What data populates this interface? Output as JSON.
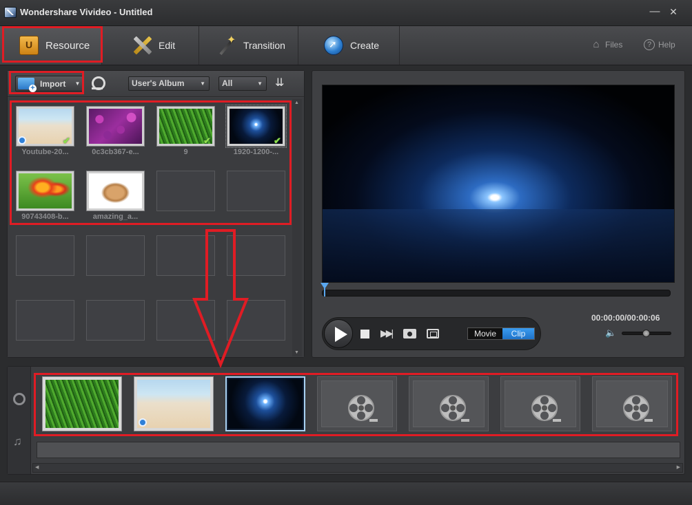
{
  "window": {
    "title": "Wondershare Vivideo - Untitled",
    "minimize_glyph": "—",
    "close_glyph": "✕"
  },
  "nav": {
    "tabs": [
      {
        "label": "Resource",
        "icon": "storage-box-icon"
      },
      {
        "label": "Edit",
        "icon": "pencil-icon"
      },
      {
        "label": "Transition",
        "icon": "magic-wand-icon"
      },
      {
        "label": "Create",
        "icon": "globe-icon"
      }
    ],
    "files_label": "Files",
    "help_label": "Help"
  },
  "resource": {
    "import_label": "Import",
    "album_select": "User's Album",
    "filter_select": "All",
    "thumbnails": [
      {
        "label": "Youtube-20...",
        "image": "beach",
        "checked": true,
        "video_badge": true
      },
      {
        "label": "0c3cb367-e...",
        "image": "flowers",
        "checked": false,
        "video_badge": false
      },
      {
        "label": "9",
        "image": "grass",
        "checked": true,
        "video_badge": false
      },
      {
        "label": "1920-1200-...",
        "image": "night-sea",
        "checked": true,
        "video_badge": false
      },
      {
        "label": "90743408-b...",
        "image": "tulip",
        "checked": false,
        "video_badge": false
      },
      {
        "label": "amazing_a...",
        "image": "kitten",
        "checked": false,
        "video_badge": false
      }
    ]
  },
  "preview": {
    "timecode": "00:00:00/00:00:06",
    "mode_movie": "Movie",
    "mode_clip": "Clip",
    "active_mode": "Clip"
  },
  "storyboard": {
    "clips": [
      {
        "image": "grass"
      },
      {
        "image": "beach",
        "video_badge": true
      },
      {
        "image": "night-sea",
        "selected": true
      },
      {
        "image": "empty"
      },
      {
        "image": "empty"
      },
      {
        "image": "empty"
      },
      {
        "image": "empty"
      }
    ]
  },
  "colors": {
    "annotation_red": "#e01c24",
    "clip_active_blue": "#2f8de4",
    "check_green": "#8fe04a"
  }
}
